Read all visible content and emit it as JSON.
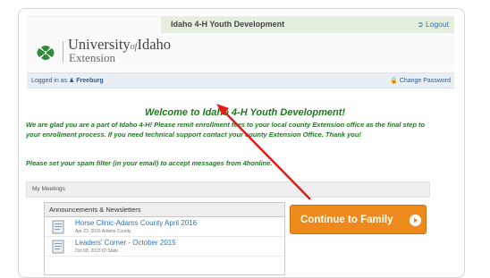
{
  "header": {
    "site_title": "Idaho 4-H Youth Development",
    "logout_label": "Logout",
    "logo_university": "University",
    "logo_of": "of",
    "logo_idaho": "Idaho",
    "logo_extension": "Extension"
  },
  "userbar": {
    "logged_in_label": "Logged in as",
    "username": "Freeburg",
    "change_password_label": "Change Password"
  },
  "welcome": {
    "title": "Welcome to Idaho 4-H Youth Development!",
    "body": "We are glad you are a part of Idaho 4-H!  Please remit enrollment fees to your local county Extension office as the final step to your enrollment process.  If you need technical support contact your county Extension Office.  Thank you!",
    "spam_note": "Please set your spam filter (in your email) to accept messages from 4honline."
  },
  "meetings": {
    "label": "My Meetings"
  },
  "announcements": {
    "header": "Announcements & Newsletters",
    "items": [
      {
        "title": "Horse Clinic-Adams County April 2016",
        "meta": "Apr 23, 2016 Adams County"
      },
      {
        "title": "Leaders' Corner - October 2015",
        "meta": "Oct 08, 2015 ID State"
      }
    ]
  },
  "continue_button": {
    "label": "Continue to Family"
  },
  "colors": {
    "green_text": "#1e7a1e",
    "link_blue": "#2a72b5",
    "button_orange": "#ee8a1c",
    "arrow_red": "#e01b1b"
  }
}
